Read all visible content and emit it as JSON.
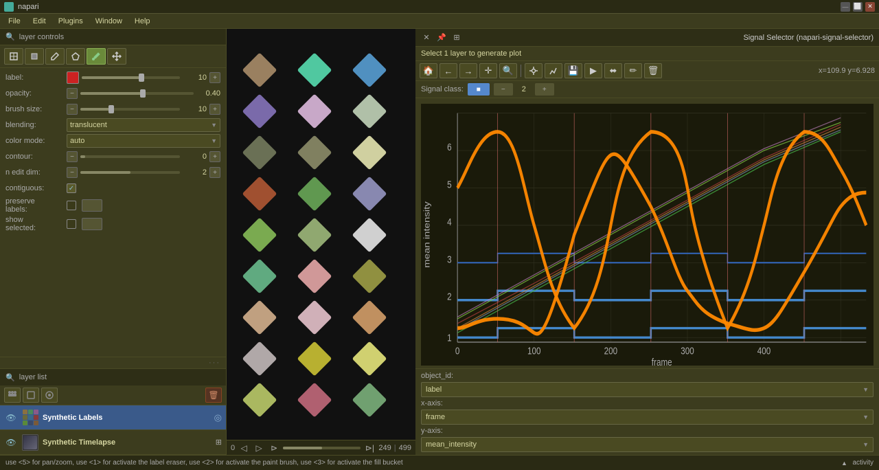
{
  "window": {
    "title": "napari",
    "titlebar_buttons": [
      "—",
      "⬜",
      "✕"
    ]
  },
  "menu": {
    "items": [
      "File",
      "Edit",
      "Plugins",
      "Window",
      "Help"
    ]
  },
  "layer_controls": {
    "header": "layer controls",
    "search_icon": "🔍",
    "tools": [
      {
        "icon": "⇄",
        "name": "transform",
        "active": false
      },
      {
        "icon": "✎",
        "name": "paint-fill",
        "active": false
      },
      {
        "icon": "✏",
        "name": "paint-brush",
        "active": false
      },
      {
        "icon": "◈",
        "name": "polygon",
        "active": false
      },
      {
        "icon": "✦",
        "name": "picker",
        "active": true
      },
      {
        "icon": "✛",
        "name": "move",
        "active": false
      }
    ],
    "properties": {
      "label": {
        "name": "label:",
        "value": "10",
        "color": "#cc2222"
      },
      "opacity": {
        "name": "opacity:",
        "value": "0.40",
        "slider_pct": 55
      },
      "brush_size": {
        "name": "brush size:",
        "value": "10",
        "slider_pct": 30
      },
      "blending": {
        "name": "blending:",
        "value": "translucent"
      },
      "color_mode": {
        "name": "color mode:",
        "value": "auto"
      },
      "contour": {
        "name": "contour:",
        "value": "0"
      },
      "n_edit_dim": {
        "name": "n edit dim:",
        "value": "2"
      },
      "contiguous": {
        "name": "contiguous:",
        "checked": true
      },
      "preserve_labels": {
        "name": "preserve\nlabels:",
        "checked": false
      },
      "show_selected": {
        "name": "show\nselected:",
        "checked": false
      }
    }
  },
  "layer_list": {
    "header": "layer list",
    "toolbar": {
      "add_point": "⊕",
      "select": "◻",
      "lasso": "◎",
      "delete": "🗑"
    },
    "layers": [
      {
        "id": "synthetic-labels",
        "name": "Synthetic Labels",
        "visible": true,
        "active": true,
        "icon_type": "labels",
        "pin": true
      },
      {
        "id": "synthetic-timelapse",
        "name": "Synthetic Timelapse",
        "visible": true,
        "active": false,
        "icon_type": "image",
        "pin": false
      }
    ]
  },
  "bottom_toolbar": {
    "buttons": [
      {
        "icon": "⊢",
        "name": "console"
      },
      {
        "icon": "⬛",
        "name": "rectangle"
      },
      {
        "icon": "⊞",
        "name": "grid"
      },
      {
        "icon": "🏠",
        "name": "home"
      },
      {
        "icon": "↙",
        "name": "split"
      },
      {
        "icon": "⊡",
        "name": "fullscreen"
      },
      {
        "icon": "⊞",
        "name": "tile"
      },
      {
        "icon": "🏠",
        "name": "reset"
      }
    ]
  },
  "canvas": {
    "frame_current": "249",
    "frame_total": "499"
  },
  "signal_selector": {
    "header": "Signal Selector (napari-signal-selector)",
    "header_icons": [
      "✕",
      "📌",
      "⊞"
    ],
    "prompt": "Select 1 layer to generate plot",
    "toolbar": {
      "home": "🏠",
      "back": "←",
      "forward": "→",
      "pan": "✛",
      "zoom": "🔍",
      "settings": "⚙",
      "line": "📈",
      "save": "💾",
      "cursor_arrow": "▶",
      "resize": "⬌",
      "pencil": "✏",
      "delete": "🗑"
    },
    "coord": "x=109.9 y=6.928",
    "signal_class": {
      "label": "Signal class:",
      "value": "2"
    },
    "plot": {
      "x_label": "frame",
      "y_label": "mean intensity",
      "x_ticks": [
        "0",
        "100",
        "200",
        "300",
        "400"
      ],
      "y_ticks": [
        "1",
        "2",
        "3",
        "4",
        "5",
        "6"
      ]
    },
    "config": {
      "object_id_label": "object_id:",
      "x_axis_label": "x-axis:",
      "y_axis_label": "y-axis:",
      "object_id_value": "label",
      "x_axis_value": "frame",
      "y_axis_value": "mean_intensity"
    }
  },
  "statusbar": {
    "text": "use <5> for pan/zoom, use <1> for activate the label eraser, use <2> for activate the paint brush, use <3> for activate the fill bucket",
    "activity_label": "activity"
  },
  "colors": {
    "bg_dark": "#2e2e16",
    "bg_mid": "#3c3c1e",
    "bg_light": "#4a4a22",
    "border": "#4a4a25",
    "accent_blue": "#3a5a8a",
    "text_primary": "#d4d4a0",
    "text_muted": "#aaaaaa"
  }
}
